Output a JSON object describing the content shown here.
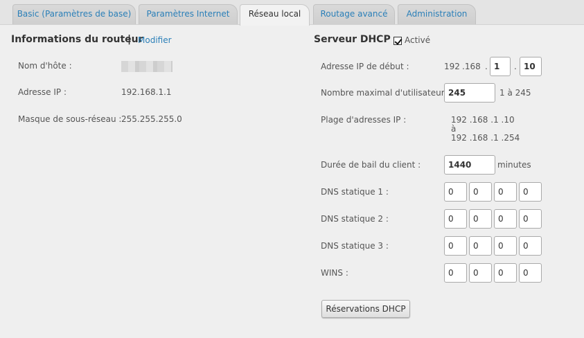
{
  "tabs": [
    {
      "label": "Basic (Paramètres de base)"
    },
    {
      "label": "Paramètres Internet"
    },
    {
      "label": "Réseau local"
    },
    {
      "label": "Routage avancé"
    },
    {
      "label": "Administration"
    }
  ],
  "router_info": {
    "title": "Informations du routeur",
    "separator": "|",
    "edit_link": "Modifier",
    "hostname_label": "Nom d'hôte :",
    "ip_label": "Adresse IP :",
    "ip_value": "192.168.1.1",
    "subnet_label": "Masque de sous-réseau :",
    "subnet_value": "255.255.255.0"
  },
  "dhcp": {
    "title": "Serveur DHCP",
    "enabled_label": "Activé",
    "enabled": true,
    "start_ip_label": "Adresse IP de début :",
    "start_ip_prefix_1": "192",
    "start_ip_prefix_2": ".168",
    "start_ip_dot_1": ".",
    "start_ip_octet3": "1",
    "start_ip_dot_2": ".",
    "start_ip_octet4": "10",
    "max_users_label": "Nombre maximal d'utilisateurs :",
    "max_users_value": "245",
    "max_users_range": "1 à 245",
    "range_label": "Plage d'adresses IP :",
    "range_start": "192 .168 .1 .10",
    "range_to": "à",
    "range_end": "192 .168 .1 .254",
    "lease_label": "Durée de bail du client :",
    "lease_value": "1440",
    "lease_unit": "minutes",
    "dns1_label": "DNS statique 1 :",
    "dns1": [
      "0",
      "0",
      "0",
      "0"
    ],
    "dns2_label": "DNS statique 2 :",
    "dns2": [
      "0",
      "0",
      "0",
      "0"
    ],
    "dns3_label": "DNS statique 3 :",
    "dns3": [
      "0",
      "0",
      "0",
      "0"
    ],
    "wins_label": "WINS :",
    "wins": [
      "0",
      "0",
      "0",
      "0"
    ],
    "reservations_button": "Réservations DHCP"
  },
  "colors": {
    "link": "#2a7fb8",
    "background": "#efefef"
  }
}
